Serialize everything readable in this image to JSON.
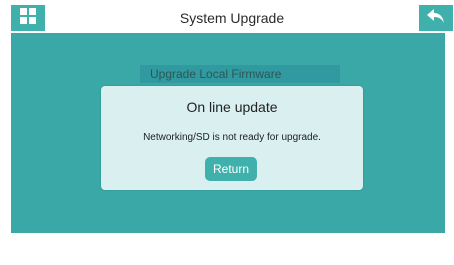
{
  "header": {
    "title": "System Upgrade",
    "menu_icon": "grid-icon",
    "back_icon": "back-arrow-icon"
  },
  "background_menu": {
    "item_label": "Upgrade Local Firmware"
  },
  "dialog": {
    "title": "On line update",
    "message": "Networking/SD is not ready for upgrade.",
    "return_label": "Return"
  },
  "colors": {
    "accent": "#3fb0ab",
    "panel": "#3aa8a6",
    "dialog_bg": "#d9eff0"
  }
}
